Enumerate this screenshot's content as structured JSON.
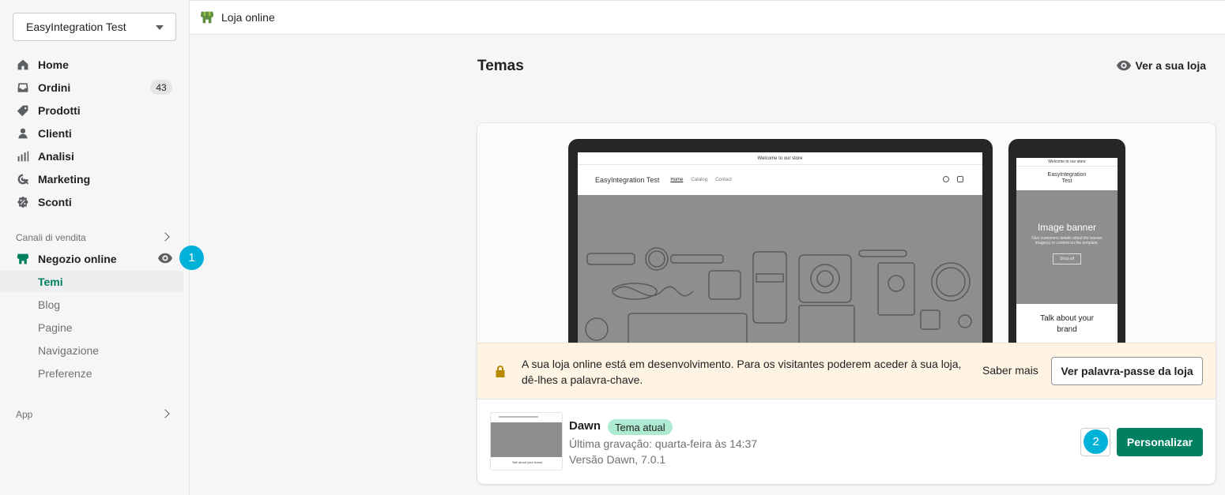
{
  "store_selector": {
    "label": "EasyIntegration Test"
  },
  "sidebar": {
    "items": [
      {
        "label": "Home",
        "icon": "home-icon"
      },
      {
        "label": "Ordini",
        "icon": "orders-icon",
        "badge": "43"
      },
      {
        "label": "Prodotti",
        "icon": "tag-icon"
      },
      {
        "label": "Clienti",
        "icon": "person-icon"
      },
      {
        "label": "Analisi",
        "icon": "analytics-icon"
      },
      {
        "label": "Marketing",
        "icon": "marketing-icon"
      },
      {
        "label": "Sconti",
        "icon": "discount-icon"
      }
    ],
    "sales_channels_label": "Canali di vendita",
    "online_store": {
      "label": "Negozio online",
      "step": "1"
    },
    "sub_items": [
      "Temi",
      "Blog",
      "Pagine",
      "Navigazione",
      "Preferenze"
    ],
    "apps_label": "App"
  },
  "topbar": {
    "title": "Loja online"
  },
  "page": {
    "title": "Temas",
    "view_store": "Ver a sua loja"
  },
  "preview": {
    "announcement": "Welcome to our store",
    "store_name": "EasyIntegration Test",
    "nav_links": [
      "Home",
      "Catalog",
      "Contact"
    ],
    "mobile_store_name": "EasyIntegration Test",
    "banner_title": "Image banner",
    "banner_subtitle": "Give customers details about the banner image(s) or content on the template.",
    "banner_button": "Shop all",
    "talk_heading": "Talk about your brand"
  },
  "notice": {
    "message": "A sua loja online está em desenvolvimento. Para os visitantes poderem aceder à sua loja, dê-lhes a palavra-chave.",
    "learn_more": "Saber mais",
    "password_button": "Ver palavra-passe da loja"
  },
  "theme": {
    "name": "Dawn",
    "tag": "Tema atual",
    "last_saved": "Última gravação: quarta-feira às 14:37",
    "version": "Versão Dawn, 7.0.1",
    "customize_button": "Personalizar",
    "step": "2"
  },
  "colors": {
    "primary": "#008060",
    "step_marker": "#00b1d8",
    "notice_bg": "#fff4e4"
  }
}
